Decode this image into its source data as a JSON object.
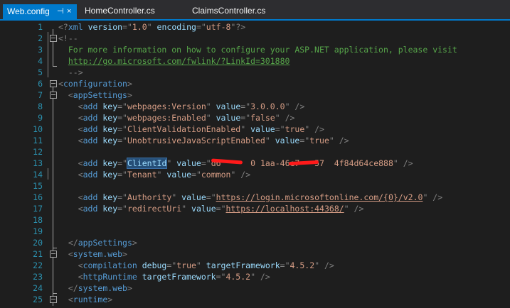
{
  "tabs": [
    {
      "label": "Web.config",
      "pin": "⊣",
      "close": "×"
    },
    {
      "label": "HomeController.cs"
    },
    {
      "label": "ClaimsController.cs"
    }
  ],
  "colors": {
    "accent": "#007acc",
    "background": "#1e1e1e",
    "line_number": "#2b91af",
    "tag": "#569cd6",
    "attribute": "#9cdcfe",
    "value": "#d69d85",
    "comment": "#57a64a"
  },
  "icons": {
    "fold": "fold-toggle-icon",
    "pin": "pin-icon",
    "close": "close-icon"
  },
  "lines": [
    {
      "n": "1",
      "segs": [
        [
          "pun",
          "<?"
        ],
        [
          "tag",
          "xml"
        ],
        [
          "txt",
          " "
        ],
        [
          "attr",
          "version"
        ],
        [
          "pun",
          "=\""
        ],
        [
          "val",
          "1.0"
        ],
        [
          "pun",
          "\" "
        ],
        [
          "attr",
          "encoding"
        ],
        [
          "pun",
          "=\""
        ],
        [
          "val",
          "utf-8"
        ],
        [
          "pun",
          "\"?>"
        ]
      ]
    },
    {
      "n": "2",
      "segs": [
        [
          "pun",
          "<!--"
        ]
      ]
    },
    {
      "n": "3",
      "segs": [
        [
          "com",
          "  For more information on how to configure your ASP.NET application, please visit"
        ]
      ]
    },
    {
      "n": "4",
      "segs": [
        [
          "com",
          "  "
        ],
        [
          "link",
          "http://go.microsoft.com/fwlink/?LinkId=301880"
        ]
      ]
    },
    {
      "n": "5",
      "segs": [
        [
          "pun",
          "  -->"
        ]
      ]
    },
    {
      "n": "6",
      "segs": [
        [
          "pun",
          "<"
        ],
        [
          "tag",
          "configuration"
        ],
        [
          "pun",
          ">"
        ]
      ]
    },
    {
      "n": "7",
      "segs": [
        [
          "pun",
          "  <"
        ],
        [
          "tag",
          "appSettings"
        ],
        [
          "pun",
          ">"
        ]
      ]
    },
    {
      "n": "8",
      "segs": [
        [
          "pun",
          "    <"
        ],
        [
          "tag",
          "add"
        ],
        [
          "txt",
          " "
        ],
        [
          "attr",
          "key"
        ],
        [
          "pun",
          "=\""
        ],
        [
          "val",
          "webpages:Version"
        ],
        [
          "pun",
          "\" "
        ],
        [
          "attr",
          "value"
        ],
        [
          "pun",
          "=\""
        ],
        [
          "val",
          "3.0.0.0"
        ],
        [
          "pun",
          "\" />"
        ]
      ]
    },
    {
      "n": "9",
      "segs": [
        [
          "pun",
          "    <"
        ],
        [
          "tag",
          "add"
        ],
        [
          "txt",
          " "
        ],
        [
          "attr",
          "key"
        ],
        [
          "pun",
          "=\""
        ],
        [
          "val",
          "webpages:Enabled"
        ],
        [
          "pun",
          "\" "
        ],
        [
          "attr",
          "value"
        ],
        [
          "pun",
          "=\""
        ],
        [
          "val",
          "false"
        ],
        [
          "pun",
          "\" />"
        ]
      ]
    },
    {
      "n": "10",
      "segs": [
        [
          "pun",
          "    <"
        ],
        [
          "tag",
          "add"
        ],
        [
          "txt",
          " "
        ],
        [
          "attr",
          "key"
        ],
        [
          "pun",
          "=\""
        ],
        [
          "val",
          "ClientValidationEnabled"
        ],
        [
          "pun",
          "\" "
        ],
        [
          "attr",
          "value"
        ],
        [
          "pun",
          "=\""
        ],
        [
          "val",
          "true"
        ],
        [
          "pun",
          "\" />"
        ]
      ]
    },
    {
      "n": "11",
      "segs": [
        [
          "pun",
          "    <"
        ],
        [
          "tag",
          "add"
        ],
        [
          "txt",
          " "
        ],
        [
          "attr",
          "key"
        ],
        [
          "pun",
          "=\""
        ],
        [
          "val",
          "UnobtrusiveJavaScriptEnabled"
        ],
        [
          "pun",
          "\" "
        ],
        [
          "attr",
          "value"
        ],
        [
          "pun",
          "=\""
        ],
        [
          "val",
          "true"
        ],
        [
          "pun",
          "\" />"
        ]
      ]
    },
    {
      "n": "12",
      "segs": []
    },
    {
      "n": "13",
      "segs": [
        [
          "pun",
          "    <"
        ],
        [
          "tag",
          "add"
        ],
        [
          "txt",
          " "
        ],
        [
          "attr",
          "key"
        ],
        [
          "pun",
          "=\""
        ],
        [
          "hl",
          "ClientId"
        ],
        [
          "pun",
          "\" "
        ],
        [
          "attr",
          "value"
        ],
        [
          "pun",
          "=\""
        ],
        [
          "val",
          "d6      0 1aa-46e7-  57  4f84d64ce888"
        ],
        [
          "pun",
          "\" />"
        ]
      ]
    },
    {
      "n": "14",
      "segs": [
        [
          "pun",
          "    <"
        ],
        [
          "tag",
          "add"
        ],
        [
          "txt",
          " "
        ],
        [
          "attr",
          "key"
        ],
        [
          "pun",
          "=\""
        ],
        [
          "val",
          "Tenant"
        ],
        [
          "pun",
          "\" "
        ],
        [
          "attr",
          "value"
        ],
        [
          "pun",
          "=\""
        ],
        [
          "val",
          "common"
        ],
        [
          "pun",
          "\" />"
        ]
      ]
    },
    {
      "n": "15",
      "segs": []
    },
    {
      "n": "16",
      "segs": [
        [
          "pun",
          "    <"
        ],
        [
          "tag",
          "add"
        ],
        [
          "txt",
          " "
        ],
        [
          "attr",
          "key"
        ],
        [
          "pun",
          "=\""
        ],
        [
          "val",
          "Authority"
        ],
        [
          "pun",
          "\" "
        ],
        [
          "attr",
          "value"
        ],
        [
          "pun",
          "=\""
        ],
        [
          "vlink",
          "https://login.microsoftonline.com/{0}/v2.0"
        ],
        [
          "pun",
          "\" />"
        ]
      ]
    },
    {
      "n": "17",
      "segs": [
        [
          "pun",
          "    <"
        ],
        [
          "tag",
          "add"
        ],
        [
          "txt",
          " "
        ],
        [
          "attr",
          "key"
        ],
        [
          "pun",
          "=\""
        ],
        [
          "val",
          "redirectUri"
        ],
        [
          "pun",
          "\" "
        ],
        [
          "attr",
          "value"
        ],
        [
          "pun",
          "=\""
        ],
        [
          "vlink",
          "https://localhost:44368/"
        ],
        [
          "pun",
          "\" />"
        ]
      ]
    },
    {
      "n": "18",
      "segs": []
    },
    {
      "n": "19",
      "segs": []
    },
    {
      "n": "20",
      "segs": [
        [
          "pun",
          "  </"
        ],
        [
          "tag",
          "appSettings"
        ],
        [
          "pun",
          ">"
        ]
      ]
    },
    {
      "n": "21",
      "segs": [
        [
          "pun",
          "  <"
        ],
        [
          "tag",
          "system.web"
        ],
        [
          "pun",
          ">"
        ]
      ]
    },
    {
      "n": "22",
      "segs": [
        [
          "pun",
          "    <"
        ],
        [
          "tag",
          "compilation"
        ],
        [
          "txt",
          " "
        ],
        [
          "attr",
          "debug"
        ],
        [
          "pun",
          "=\""
        ],
        [
          "val",
          "true"
        ],
        [
          "pun",
          "\" "
        ],
        [
          "attr",
          "targetFramework"
        ],
        [
          "pun",
          "=\""
        ],
        [
          "val",
          "4.5.2"
        ],
        [
          "pun",
          "\" />"
        ]
      ]
    },
    {
      "n": "23",
      "segs": [
        [
          "pun",
          "    <"
        ],
        [
          "tag",
          "httpRuntime"
        ],
        [
          "txt",
          " "
        ],
        [
          "attr",
          "targetFramework"
        ],
        [
          "pun",
          "=\""
        ],
        [
          "val",
          "4.5.2"
        ],
        [
          "pun",
          "\" />"
        ]
      ]
    },
    {
      "n": "24",
      "segs": [
        [
          "pun",
          "  </"
        ],
        [
          "tag",
          "system.web"
        ],
        [
          "pun",
          ">"
        ]
      ]
    },
    {
      "n": "25",
      "segs": [
        [
          "pun",
          "  <"
        ],
        [
          "tag",
          "runtime"
        ],
        [
          "pun",
          ">"
        ]
      ]
    }
  ]
}
